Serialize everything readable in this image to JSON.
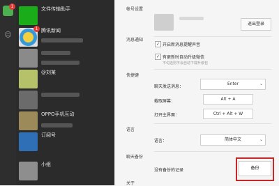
{
  "chat_list": {
    "items": [
      {
        "title": "文件传输助手",
        "sub": "",
        "time": ""
      },
      {
        "title": "腾讯新闻",
        "sub": "",
        "time": "",
        "badge": "1"
      },
      {
        "title": "",
        "sub": "",
        "time": ""
      },
      {
        "title": "@刘某",
        "sub": "",
        "time": ""
      },
      {
        "title": "",
        "sub": "",
        "time": ""
      },
      {
        "title": "OPPO手机互动",
        "sub": "",
        "time": ""
      },
      {
        "title": "订阅号",
        "sub": "",
        "time": ""
      },
      {
        "title": "小组",
        "sub": "",
        "time": ""
      }
    ]
  },
  "rail": {
    "badge": "1"
  },
  "settings": {
    "account_label": "帐号设置",
    "logout_button": "退出登录",
    "notify_label": "消息通知",
    "notify_option": "开启新消息提醒声音",
    "update_option": "有更新时自动升级微信",
    "update_note": "不勾选则不会自动下载升级包",
    "shortcut_label": "快捷键",
    "send_label": "聊天发送消息：",
    "send_value": "Enter",
    "screenshot_label": "截取屏幕：",
    "screenshot_value": "Alt + A",
    "open_label": "打开主界面：",
    "open_value": "Ctrl + Alt + W",
    "language_section": "语言",
    "language_label": "语言：",
    "language_value": "简体中文",
    "backup_section": "聊天备份",
    "backup_status": "没有备份的记录",
    "backup_button": "备份",
    "about_label": "关于"
  },
  "colors": {
    "highlight": "#c62828",
    "accent": "#4caf50"
  }
}
